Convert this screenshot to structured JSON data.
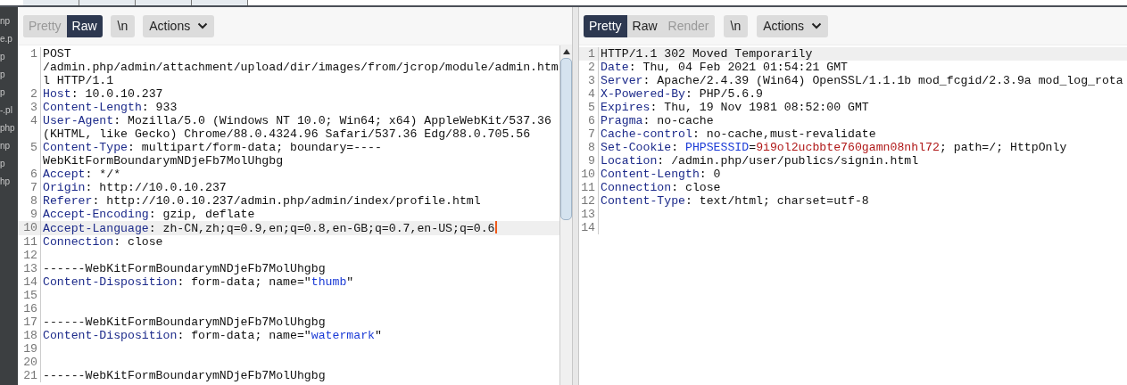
{
  "sidebar": {
    "items": [
      {
        "label": "np"
      },
      {
        "label": "e.p"
      },
      {
        "label": "p"
      },
      {
        "label": "p"
      },
      {
        "label": "p"
      },
      {
        "label": "-.pl"
      },
      {
        "label": "php"
      },
      {
        "label": "np"
      },
      {
        "label": "p"
      },
      {
        "label": "hp"
      }
    ]
  },
  "request": {
    "views": [
      {
        "label": "Pretty",
        "selected": false,
        "disabled": true
      },
      {
        "label": "Raw",
        "selected": true,
        "disabled": false
      }
    ],
    "newline_button": "\\n",
    "actions_button": "Actions",
    "caret": true,
    "lines": [
      {
        "number": "1",
        "current": false,
        "parts": [
          {
            "kind": "text",
            "text": "POST /admin.php/admin/attachment/upload/dir/images/from/jcrop/module/admin.html HTTP/1.1"
          }
        ]
      },
      {
        "number": "2",
        "current": false,
        "parts": [
          {
            "kind": "name",
            "text": "Host"
          },
          {
            "kind": "text",
            "text": ": 10.0.10.237"
          }
        ]
      },
      {
        "number": "3",
        "current": false,
        "parts": [
          {
            "kind": "name",
            "text": "Content-Length"
          },
          {
            "kind": "text",
            "text": ": 933"
          }
        ]
      },
      {
        "number": "4",
        "current": false,
        "parts": [
          {
            "kind": "name",
            "text": "User-Agent"
          },
          {
            "kind": "text",
            "text": ": Mozilla/5.0 (Windows NT 10.0; Win64; x64) AppleWebKit/537.36 (KHTML, like Gecko) Chrome/88.0.4324.96 Safari/537.36 Edg/88.0.705.56"
          }
        ]
      },
      {
        "number": "5",
        "current": false,
        "parts": [
          {
            "kind": "name",
            "text": "Content-Type"
          },
          {
            "kind": "text",
            "text": ": multipart/form-data; boundary=----WebKitFormBoundarymNDjeFb7MolUhgbg"
          }
        ]
      },
      {
        "number": "6",
        "current": false,
        "parts": [
          {
            "kind": "name",
            "text": "Accept"
          },
          {
            "kind": "text",
            "text": ": */*"
          }
        ]
      },
      {
        "number": "7",
        "current": false,
        "parts": [
          {
            "kind": "name",
            "text": "Origin"
          },
          {
            "kind": "text",
            "text": ": http://10.0.10.237"
          }
        ]
      },
      {
        "number": "8",
        "current": false,
        "parts": [
          {
            "kind": "name",
            "text": "Referer"
          },
          {
            "kind": "text",
            "text": ": http://10.0.10.237/admin.php/admin/index/profile.html"
          }
        ]
      },
      {
        "number": "9",
        "current": false,
        "parts": [
          {
            "kind": "name",
            "text": "Accept-Encoding"
          },
          {
            "kind": "text",
            "text": ": gzip, deflate"
          }
        ]
      },
      {
        "number": "10",
        "current": true,
        "parts": [
          {
            "kind": "name",
            "text": "Accept-Language"
          },
          {
            "kind": "text",
            "text": ": zh-CN,zh;q=0.9,en;q=0.8,en-GB;q=0.7,en-US;q=0.6"
          }
        ]
      },
      {
        "number": "11",
        "current": false,
        "parts": [
          {
            "kind": "name",
            "text": "Connection"
          },
          {
            "kind": "text",
            "text": ": close"
          }
        ]
      },
      {
        "number": "12",
        "current": false
      },
      {
        "number": "13",
        "current": false,
        "parts": [
          {
            "kind": "text",
            "text": "------WebKitFormBoundarymNDjeFb7MolUhgbg"
          }
        ]
      },
      {
        "number": "14",
        "current": false,
        "parts": [
          {
            "kind": "name",
            "text": "Content-Disposition"
          },
          {
            "kind": "text",
            "text": ": form-data; name=\""
          },
          {
            "kind": "value",
            "text": "thumb"
          },
          {
            "kind": "text",
            "text": "\""
          }
        ]
      },
      {
        "number": "15",
        "current": false
      },
      {
        "number": "16",
        "current": false
      },
      {
        "number": "17",
        "current": false,
        "parts": [
          {
            "kind": "text",
            "text": "------WebKitFormBoundarymNDjeFb7MolUhgbg"
          }
        ]
      },
      {
        "number": "18",
        "current": false,
        "parts": [
          {
            "kind": "name",
            "text": "Content-Disposition"
          },
          {
            "kind": "text",
            "text": ": form-data; name=\""
          },
          {
            "kind": "value",
            "text": "watermark"
          },
          {
            "kind": "text",
            "text": "\""
          }
        ]
      },
      {
        "number": "19",
        "current": false
      },
      {
        "number": "20",
        "current": false
      },
      {
        "number": "21",
        "current": false,
        "parts": [
          {
            "kind": "text",
            "text": "------WebKitFormBoundarymNDjeFb7MolUhgbg"
          }
        ]
      }
    ]
  },
  "response": {
    "views": [
      {
        "label": "Pretty",
        "selected": true,
        "disabled": false
      },
      {
        "label": "Raw",
        "selected": false,
        "disabled": false
      },
      {
        "label": "Render",
        "selected": false,
        "disabled": true
      }
    ],
    "newline_button": "\\n",
    "actions_button": "Actions",
    "lines": [
      {
        "number": "1",
        "current": true,
        "parts": [
          {
            "kind": "text",
            "text": "HTTP/1.1 302 Moved Temporarily"
          }
        ]
      },
      {
        "number": "2",
        "current": false,
        "parts": [
          {
            "kind": "name",
            "text": "Date"
          },
          {
            "kind": "text",
            "text": ": Thu, 04 Feb 2021 01:54:21 GMT"
          }
        ]
      },
      {
        "number": "3",
        "current": false,
        "parts": [
          {
            "kind": "name",
            "text": "Server"
          },
          {
            "kind": "text",
            "text": ": Apache/2.4.39 (Win64) OpenSSL/1.1.1b mod_fcgid/2.3.9a mod_log_rota"
          }
        ]
      },
      {
        "number": "4",
        "current": false,
        "parts": [
          {
            "kind": "name",
            "text": "X-Powered-By"
          },
          {
            "kind": "text",
            "text": ": PHP/5.6.9"
          }
        ]
      },
      {
        "number": "5",
        "current": false,
        "parts": [
          {
            "kind": "name",
            "text": "Expires"
          },
          {
            "kind": "text",
            "text": ": Thu, 19 Nov 1981 08:52:00 GMT"
          }
        ]
      },
      {
        "number": "6",
        "current": false,
        "parts": [
          {
            "kind": "name",
            "text": "Pragma"
          },
          {
            "kind": "text",
            "text": ": no-cache"
          }
        ]
      },
      {
        "number": "7",
        "current": false,
        "parts": [
          {
            "kind": "name",
            "text": "Cache-control"
          },
          {
            "kind": "text",
            "text": ": no-cache,must-revalidate"
          }
        ]
      },
      {
        "number": "8",
        "current": false,
        "parts": [
          {
            "kind": "name",
            "text": "Set-Cookie"
          },
          {
            "kind": "text",
            "text": ": "
          },
          {
            "kind": "value",
            "text": "PHPSESSID"
          },
          {
            "kind": "text",
            "text": "="
          },
          {
            "kind": "secret",
            "text": "9i9ol2ucbbte760gamn08nhl72"
          },
          {
            "kind": "text",
            "text": "; path=/; HttpOnly"
          }
        ]
      },
      {
        "number": "9",
        "current": false,
        "parts": [
          {
            "kind": "name",
            "text": "Location"
          },
          {
            "kind": "text",
            "text": ": /admin.php/user/publics/signin.html"
          }
        ]
      },
      {
        "number": "10",
        "current": false,
        "parts": [
          {
            "kind": "name",
            "text": "Content-Length"
          },
          {
            "kind": "text",
            "text": ": 0"
          }
        ]
      },
      {
        "number": "11",
        "current": false,
        "parts": [
          {
            "kind": "name",
            "text": "Connection"
          },
          {
            "kind": "text",
            "text": ": close"
          }
        ]
      },
      {
        "number": "12",
        "current": false,
        "parts": [
          {
            "kind": "name",
            "text": "Content-Type"
          },
          {
            "kind": "text",
            "text": ": text/html; charset=utf-8"
          }
        ]
      },
      {
        "number": "13",
        "current": false
      },
      {
        "number": "14",
        "current": false
      }
    ]
  }
}
